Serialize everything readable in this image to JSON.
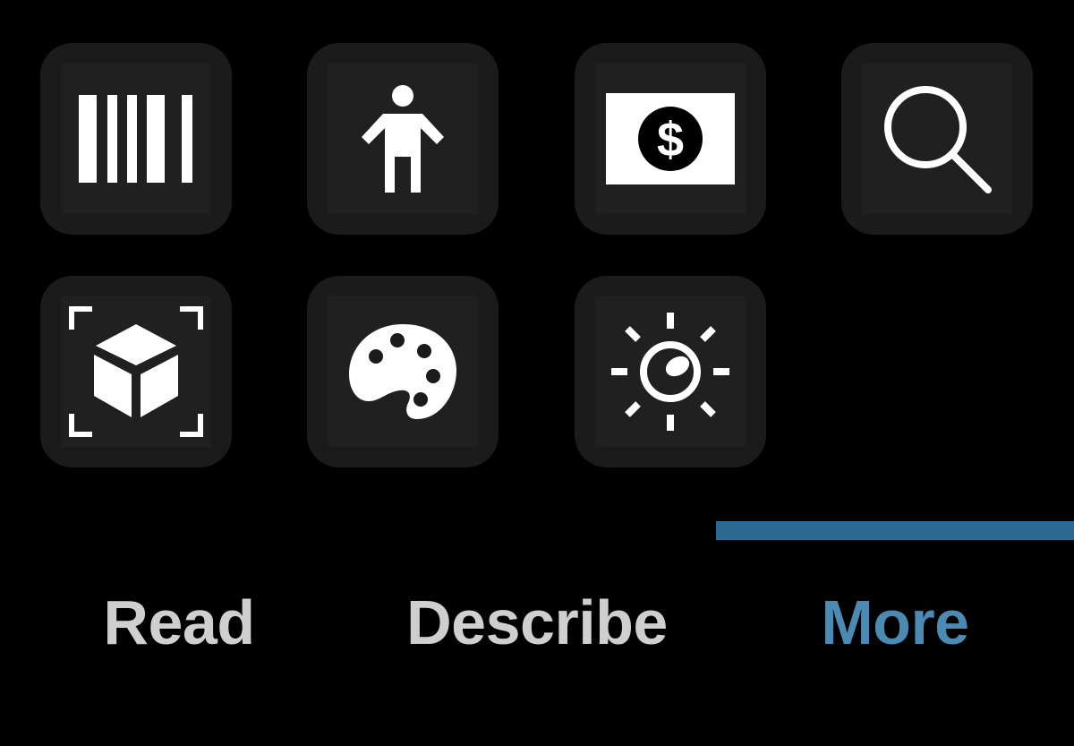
{
  "icons": {
    "tiles": [
      {
        "name": "barcode-icon"
      },
      {
        "name": "person-icon"
      },
      {
        "name": "currency-icon"
      },
      {
        "name": "search-icon"
      },
      {
        "name": "object-scan-icon"
      },
      {
        "name": "color-palette-icon"
      },
      {
        "name": "light-icon"
      }
    ]
  },
  "tabs": {
    "read_label": "Read",
    "describe_label": "Describe",
    "more_label": "More",
    "selected": "More"
  },
  "colors": {
    "background": "#000000",
    "tile": "#1b1b1b",
    "icon": "#ffffff",
    "tab_inactive": "#cfcfcf",
    "tab_active": "#4a8ab3",
    "indicator": "#2d6a93"
  }
}
